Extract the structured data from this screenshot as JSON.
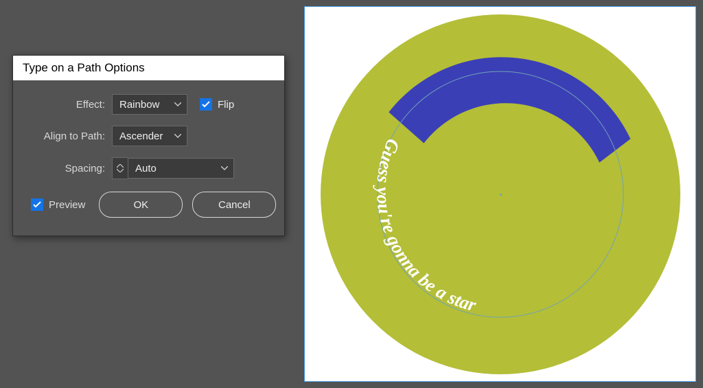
{
  "dialog": {
    "title": "Type on a Path Options",
    "effect": {
      "label": "Effect:",
      "value": "Rainbow"
    },
    "align": {
      "label": "Align to Path:",
      "value": "Ascender"
    },
    "spacing": {
      "label": "Spacing:",
      "value": "Auto"
    },
    "flip": {
      "label": "Flip",
      "checked": true
    },
    "preview": {
      "label": "Preview",
      "checked": true
    },
    "ok": "OK",
    "cancel": "Cancel"
  },
  "artwork": {
    "disc_fill": "#b4be37",
    "arc_fill": "#3b3fb6",
    "ring_stroke": "#6fa3b7",
    "path_text": "Guess you're gonna be a star",
    "text_color": "#ffffff"
  }
}
